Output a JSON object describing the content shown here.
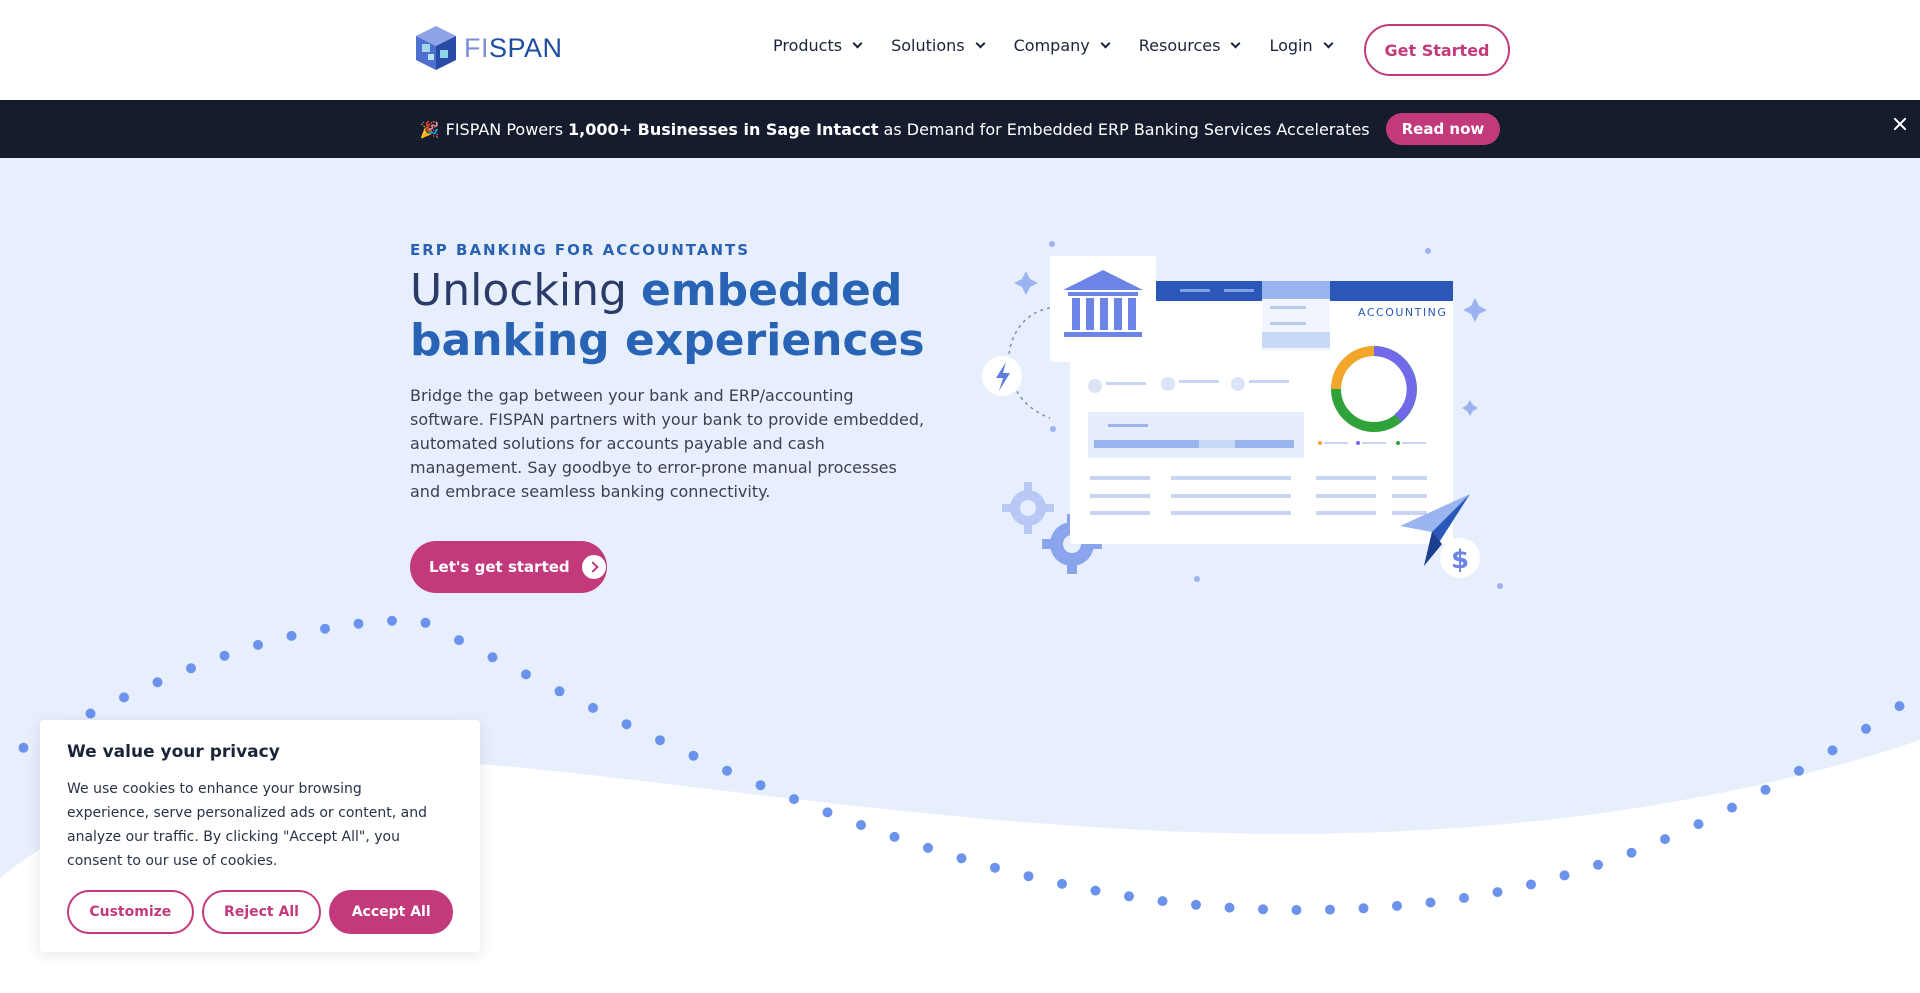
{
  "header": {
    "logo_text_fi": "FI",
    "logo_text_span": "SPAN",
    "nav": [
      {
        "label": "Products"
      },
      {
        "label": "Solutions"
      },
      {
        "label": "Company"
      },
      {
        "label": "Resources"
      },
      {
        "label": "Login"
      }
    ],
    "cta_label": "Get Started"
  },
  "banner": {
    "prefix": "FISPAN Powers",
    "bold": "1,000+ Businesses in Sage Intacct",
    "suffix": "as Demand for Embedded ERP Banking Services Accelerates",
    "button_label": "Read now",
    "party_icon": "party-popper-icon"
  },
  "hero": {
    "eyebrow": "ERP BANKING FOR ACCOUNTANTS",
    "headline_plain": "Unlocking",
    "headline_accent_1": "embedded",
    "headline_accent_2": "banking experiences",
    "body": "Bridge the gap between your bank and ERP/accounting software. FISPAN partners with your bank to provide embedded, automated solutions for accounts payable and cash management. Say goodbye to error-prone manual processes and embrace seamless banking connectivity.",
    "cta_label": "Let's get started",
    "illustration_label": "ACCOUNTING"
  },
  "cookie": {
    "title": "We value your privacy",
    "text": "We use cookies to enhance your browsing experience, serve personalized ads or content, and analyze our traffic. By clicking \"Accept All\", you consent to our use of cookies.",
    "customize_label": "Customize",
    "reject_label": "Reject All",
    "accept_label": "Accept All"
  },
  "colors": {
    "brand_pink": "#c23a7c",
    "brand_blue": "#2863b5",
    "banner_bg": "#141c2e",
    "hero_bg": "#e8effc"
  }
}
